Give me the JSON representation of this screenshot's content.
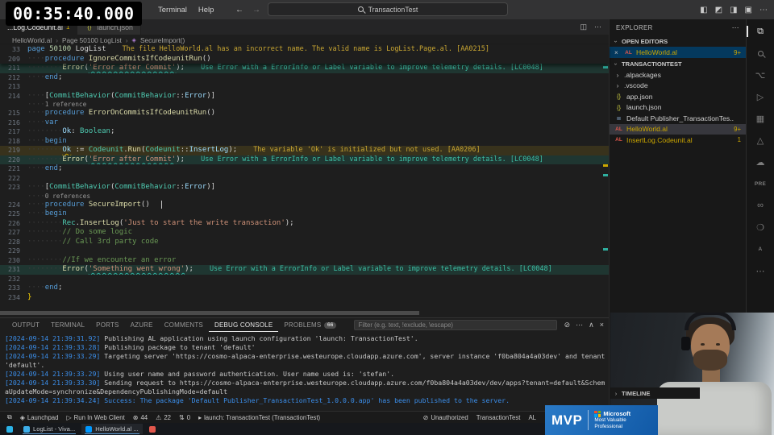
{
  "timer": "00:35:40.000",
  "titlebar": {
    "menus": [
      "Terminal",
      "Help"
    ],
    "back": "←",
    "forward": "→",
    "search": "TransactionTest",
    "window_icons": [
      "◧",
      "◩",
      "◨",
      "▣",
      "⋯"
    ]
  },
  "tabs": [
    {
      "label": "...Log.Codeunit.al",
      "badge": "1",
      "active": true,
      "icon": ""
    },
    {
      "label": "launch.json",
      "badge": "",
      "active": false,
      "icon": "{}"
    }
  ],
  "tab_actions": [
    "◫",
    "⋯"
  ],
  "breadcrumb": [
    "HelloWorld.al",
    "Page 50100 LogList",
    "SecureImport()"
  ],
  "editor": {
    "rows": [
      {
        "sticky": true,
        "n": "33",
        "t": [
          [
            "kw",
            "page"
          ],
          [
            "pl",
            " "
          ],
          [
            "num",
            "50100"
          ],
          [
            "pl",
            " "
          ],
          [
            "pl",
            "LogList"
          ]
        ],
        "note": "The file HelloWorld.al has an incorrect name. The valid name is LogList.Page.al. [AA0215]",
        "noteType": "warn"
      },
      {
        "sticky": true,
        "n": "209",
        "t": [
          [
            "ws",
            "····"
          ],
          [
            "kw",
            "procedure"
          ],
          [
            "pl",
            " "
          ],
          [
            "fn",
            "IgnoreCommitsIfCodeunitRun"
          ],
          [
            "pl",
            "()"
          ]
        ]
      },
      {
        "n": "211",
        "hl": "info",
        "t": [
          [
            "ws",
            "········"
          ],
          [
            "fn",
            "Error"
          ],
          [
            "pl",
            "("
          ],
          [
            "str sq-info",
            "'Error after Commit'"
          ],
          [
            "pl",
            ");"
          ]
        ],
        "note": "Use Error with a ErrorInfo or Label variable to improve telemetry details. [LC0048]",
        "noteType": "info"
      },
      {
        "n": "212",
        "t": [
          [
            "ws",
            "····"
          ],
          [
            "kw",
            "end"
          ],
          [
            "pl",
            ";"
          ]
        ]
      },
      {
        "n": "213",
        "t": []
      },
      {
        "n": "214",
        "t": [
          [
            "ws",
            "····"
          ],
          [
            "pl",
            "["
          ],
          [
            "ty",
            "CommitBehavior"
          ],
          [
            "pl",
            "("
          ],
          [
            "ty",
            "CommitBehavior"
          ],
          [
            "pl",
            "::"
          ],
          [
            "vr",
            "Error"
          ],
          [
            "pl",
            ")]"
          ]
        ]
      },
      {
        "lens": true,
        "t": [
          [
            "ws",
            "····"
          ],
          [
            "lenst",
            "1 reference"
          ]
        ]
      },
      {
        "n": "215",
        "t": [
          [
            "ws",
            "····"
          ],
          [
            "kw",
            "procedure"
          ],
          [
            "pl",
            " "
          ],
          [
            "fn",
            "ErrorOnCommitsIfCodeunitRun"
          ],
          [
            "pl",
            "()"
          ]
        ]
      },
      {
        "n": "216",
        "t": [
          [
            "ws",
            "····"
          ],
          [
            "kw",
            "var"
          ]
        ]
      },
      {
        "n": "217",
        "t": [
          [
            "ws",
            "········"
          ],
          [
            "vr",
            "Ok"
          ],
          [
            "pl",
            ": "
          ],
          [
            "ty",
            "Boolean"
          ],
          [
            "pl",
            ";"
          ]
        ]
      },
      {
        "n": "218",
        "t": [
          [
            "ws",
            "····"
          ],
          [
            "kw",
            "begin"
          ]
        ]
      },
      {
        "n": "219",
        "hl": "warn",
        "t": [
          [
            "ws",
            "········"
          ],
          [
            "vr sq-warn",
            "Ok"
          ],
          [
            "pl",
            " := "
          ],
          [
            "ty",
            "Codeunit"
          ],
          [
            "pl",
            "."
          ],
          [
            "fn",
            "Run"
          ],
          [
            "pl",
            "("
          ],
          [
            "ty",
            "Codeunit"
          ],
          [
            "pl",
            "::"
          ],
          [
            "vr",
            "InsertLog"
          ],
          [
            "pl",
            ");"
          ]
        ],
        "note": "The variable 'Ok' is initialized but not used. [AA0206]",
        "noteType": "warn"
      },
      {
        "n": "220",
        "hl": "info",
        "t": [
          [
            "ws",
            "········"
          ],
          [
            "fn",
            "Error"
          ],
          [
            "pl",
            "("
          ],
          [
            "str sq-info",
            "'Error after Commit'"
          ],
          [
            "pl",
            ");"
          ]
        ],
        "note": "Use Error with a ErrorInfo or Label variable to improve telemetry details. [LC0048]",
        "noteType": "info"
      },
      {
        "n": "221",
        "t": [
          [
            "ws",
            "····"
          ],
          [
            "kw",
            "end"
          ],
          [
            "pl",
            ";"
          ]
        ]
      },
      {
        "n": "222",
        "t": []
      },
      {
        "n": "223",
        "t": [
          [
            "ws",
            "····"
          ],
          [
            "pl",
            "["
          ],
          [
            "ty",
            "CommitBehavior"
          ],
          [
            "pl",
            "("
          ],
          [
            "ty",
            "CommitBehavior"
          ],
          [
            "pl",
            "::"
          ],
          [
            "vr",
            "Error"
          ],
          [
            "pl",
            ")]"
          ]
        ]
      },
      {
        "lens": true,
        "t": [
          [
            "ws",
            "····"
          ],
          [
            "lenst",
            "0 references"
          ]
        ]
      },
      {
        "n": "224",
        "cursor": true,
        "t": [
          [
            "ws",
            "····"
          ],
          [
            "kw",
            "procedure"
          ],
          [
            "pl",
            " "
          ],
          [
            "fn",
            "SecureImport"
          ],
          [
            "pl",
            "()"
          ]
        ]
      },
      {
        "n": "225",
        "t": [
          [
            "ws",
            "····"
          ],
          [
            "kw",
            "begin"
          ]
        ]
      },
      {
        "n": "226",
        "t": [
          [
            "ws",
            "········"
          ],
          [
            "ty",
            "Rec"
          ],
          [
            "pl",
            "."
          ],
          [
            "fn",
            "InsertLog"
          ],
          [
            "pl",
            "("
          ],
          [
            "str",
            "'Just to start the write transaction'"
          ],
          [
            "pl",
            ");"
          ]
        ]
      },
      {
        "n": "227",
        "t": [
          [
            "ws",
            "········"
          ],
          [
            "cmt",
            "// Do some logic"
          ]
        ]
      },
      {
        "n": "228",
        "t": [
          [
            "ws",
            "········"
          ],
          [
            "cmt",
            "// Call 3rd party code"
          ]
        ]
      },
      {
        "n": "229",
        "t": []
      },
      {
        "n": "230",
        "t": [
          [
            "ws",
            "········"
          ],
          [
            "cmt",
            "//If we encounter an error"
          ]
        ]
      },
      {
        "n": "231",
        "hl": "info",
        "t": [
          [
            "ws",
            "········"
          ],
          [
            "fn",
            "Error"
          ],
          [
            "pl",
            "("
          ],
          [
            "str sq-info",
            "'Something went wrong'"
          ],
          [
            "pl",
            ");"
          ]
        ],
        "note": "Use Error with a ErrorInfo or Label variable to improve telemetry details. [LC0048]",
        "noteType": "info"
      },
      {
        "n": "232",
        "t": []
      },
      {
        "n": "233",
        "t": [
          [
            "ws",
            "····"
          ],
          [
            "kw",
            "end"
          ],
          [
            "pl",
            ";"
          ]
        ]
      },
      {
        "n": "234",
        "t": [
          [
            "br",
            "}"
          ]
        ]
      }
    ]
  },
  "panel": {
    "tabs": [
      {
        "label": "OUTPUT"
      },
      {
        "label": "TERMINAL"
      },
      {
        "label": "PORTS"
      },
      {
        "label": "AZURE"
      },
      {
        "label": "COMMENTS"
      },
      {
        "label": "DEBUG CONSOLE",
        "active": true
      },
      {
        "label": "PROBLEMS",
        "badge": "66"
      }
    ],
    "filter_placeholder": "Filter (e.g. text, !exclude, \\escape)",
    "actions": [
      "⊘",
      "⋯",
      "∧",
      "×"
    ],
    "console": [
      {
        "ts": "[2024-09-14 21:39:31.92]",
        "text": "Publishing AL application using launch configuration 'launch: TransactionTest'."
      },
      {
        "ts": "[2024-09-14 21:39:33.28]",
        "text": "Publishing package to tenant 'default'"
      },
      {
        "ts": "[2024-09-14 21:39:33.29]",
        "text": "Targeting server 'https://cosmo-alpaca-enterprise.westeurope.cloudapp.azure.com', server instance 'f0ba804a4a03dev' and tenant 'default'."
      },
      {
        "ts": "[2024-09-14 21:39:33.29]",
        "text": "Using user name and password authentication. User name used is: 'stefan'."
      },
      {
        "ts": "[2024-09-14 21:39:33.30]",
        "text": "Sending request to https://cosmo-alpaca-enterprise.westeurope.cloudapp.azure.com/f0ba804a4a03dev/dev/apps?tenant=default&SchemaUpdateMode=synchronize&DependencyPublishingMode=default"
      },
      {
        "ts": "[2024-09-14 21:39:34.24]",
        "text": "Success: The package 'Default Publisher_TransactionTest_1.0.0.0.app' has been published to the server.",
        "kind": "success"
      }
    ]
  },
  "sidebar": {
    "title": "EXPLORER",
    "title_more": "⋯",
    "open_editors_label": "OPEN EDITORS",
    "open_editors": [
      {
        "label": "HelloWorld.al",
        "badge": "9+"
      }
    ],
    "section_label": "TRANSACTIONTEST",
    "files": [
      {
        "kind": "folder",
        "label": ".alpackages"
      },
      {
        "kind": "folder",
        "label": ".vscode"
      },
      {
        "kind": "json",
        "label": "app.json"
      },
      {
        "kind": "json",
        "label": "launch.json"
      },
      {
        "kind": "doc",
        "label": "Default Publisher_TransactionTes.."
      },
      {
        "kind": "al",
        "label": "HelloWorld.al",
        "badge": "9+",
        "active": true,
        "warn": true
      },
      {
        "kind": "al",
        "label": "InsertLog.Codeunit.al",
        "badge": "1",
        "warn": true
      }
    ],
    "timeline_label": "TIMELINE"
  },
  "activitybar": [
    {
      "name": "explorer",
      "glyph": "⧉",
      "active": true
    },
    {
      "name": "search",
      "css": "mag"
    },
    {
      "name": "source-control",
      "glyph": "⌥"
    },
    {
      "name": "run-debug",
      "glyph": "▷"
    },
    {
      "name": "extensions",
      "glyph": "▦"
    },
    {
      "name": "test",
      "glyph": "△"
    },
    {
      "name": "azure",
      "glyph": "☁"
    },
    {
      "name": "al-pre",
      "glyph": "PRE",
      "text": true
    },
    {
      "name": "azure-pipelines",
      "glyph": "∞"
    },
    {
      "name": "comments",
      "glyph": "❍"
    },
    {
      "name": "letter-a",
      "glyph": "A",
      "text": true
    },
    {
      "name": "more",
      "glyph": "⋯"
    }
  ],
  "statusbar": {
    "left": [
      {
        "name": "remote",
        "icon": "⧉",
        "label": ""
      },
      {
        "name": "launchpad",
        "icon": "◈",
        "label": "Launchpad"
      },
      {
        "name": "run-in-web-client",
        "icon": "▷",
        "label": "Run In Web Client"
      },
      {
        "name": "errors",
        "icon": "⊗",
        "label": "44"
      },
      {
        "name": "warnings",
        "icon": "⚠",
        "label": "22"
      },
      {
        "name": "ports",
        "icon": "⇅",
        "label": "0"
      },
      {
        "name": "launch-config",
        "icon": "▸",
        "label": "launch: TransactionTest (TransactionTest)"
      }
    ],
    "right": [
      {
        "name": "unauthorized",
        "icon": "⊘",
        "label": "Unauthorized"
      },
      {
        "name": "workspace",
        "icon": "",
        "label": "TransactionTest"
      },
      {
        "name": "language-mode",
        "icon": "",
        "label": "AL"
      }
    ]
  },
  "taskbar": [
    {
      "name": "pinned-app-1",
      "color": "#2bb3e8",
      "label": "",
      "open": false,
      "active": false
    },
    {
      "name": "window-loglist",
      "color": "#3daee9",
      "label": "LogList - Viva...",
      "open": true,
      "active": false
    },
    {
      "name": "window-helloworld",
      "color": "#0098ff",
      "label": "HelloWorld.al ...",
      "open": true,
      "active": true
    },
    {
      "name": "pinned-app-2",
      "color": "#e2574c",
      "label": "",
      "open": false,
      "active": false
    }
  ],
  "mvp": {
    "big": "MVP",
    "brand": "Microsoft",
    "line1": "Most Valuable",
    "line2": "Professional"
  },
  "colors": {
    "accent": "#0078d4",
    "info": "#3ebfa5",
    "warn": "#cca700",
    "error": "#f14c4c"
  }
}
